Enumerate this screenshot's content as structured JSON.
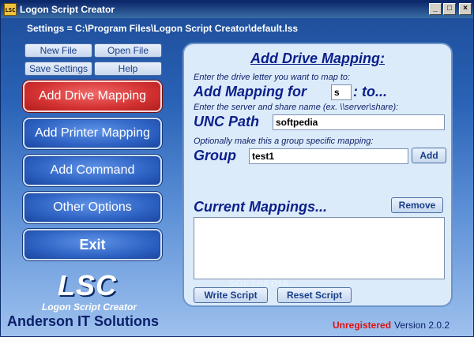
{
  "window": {
    "title": "Logon Script Creator",
    "icon_text": "LSC",
    "controls": [
      "_",
      "□",
      "×"
    ]
  },
  "settings": {
    "path": "Settings = C:\\Program Files\\Logon Script Creator\\default.lss"
  },
  "small_buttons": {
    "new_file": "New File",
    "open_file": "Open File",
    "save_settings": "Save Settings",
    "help": "Help"
  },
  "nav": {
    "add_drive_mapping": "Add Drive Mapping",
    "add_printer_mapping": "Add Printer Mapping",
    "add_command": "Add Command",
    "other_options": "Other Options",
    "exit": "Exit"
  },
  "branding": {
    "logo": "LSC",
    "tagline": "Logon Script Creator",
    "company": "Anderson IT Solutions"
  },
  "panel": {
    "title": "Add Drive Mapping:",
    "drive_hint": "Enter the drive letter you want to map to:",
    "add_mapping_label": "Add Mapping for",
    "drive_letter": "s",
    "to_label": ": to...",
    "server_hint": "Enter the server and share name (ex. \\\\server\\share):",
    "unc_label": "UNC Path",
    "unc_value": "softpedia",
    "group_hint": "Optionally make this a group specific mapping:",
    "group_label": "Group",
    "group_value": "test1",
    "add_button": "Add",
    "current_mappings_label": "Current Mappings...",
    "remove_button": "Remove",
    "write_script_button": "Write Script",
    "reset_script_button": "Reset Script"
  },
  "status": {
    "registration": "Unregistered",
    "version": "Version 2.0.2"
  },
  "watermark": "SOFTPEDIA",
  "colors": {
    "accent_red": "#d43232",
    "nav_blue": "#2e63c4",
    "panel_bg": "#dcebfa",
    "text_navy": "#0b1f8a"
  }
}
